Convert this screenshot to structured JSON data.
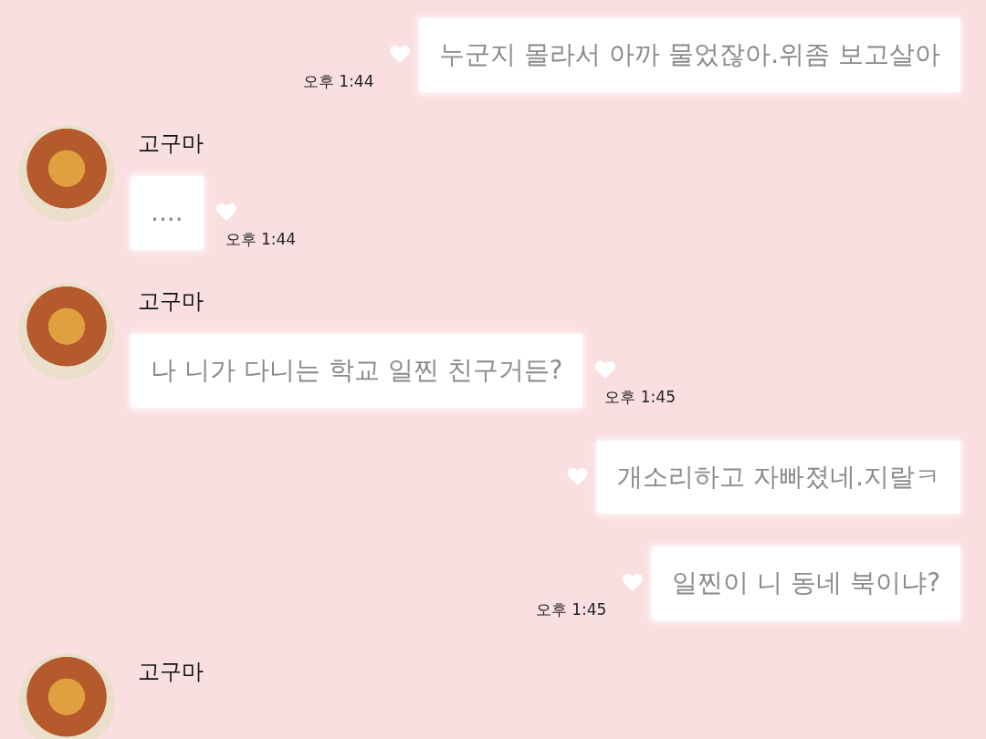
{
  "messages": [
    {
      "kind": "sent",
      "text": "누군지 몰라서 아까 물었잖아.위좀 보고살아",
      "time": "오후 1:44"
    },
    {
      "kind": "received",
      "sender": "고구마",
      "text": "....",
      "time": "오후 1:44"
    },
    {
      "kind": "received",
      "sender": "고구마",
      "text": "나 니가 다니는 학교 일찐 친구거든?",
      "time": "오후 1:45"
    },
    {
      "kind": "sent",
      "text": "개소리하고 자빠졌네.지랄ㅋ"
    },
    {
      "kind": "sent",
      "text": "일찐이 니 동네 북이냐?",
      "time": "오후 1:45"
    },
    {
      "kind": "received",
      "sender": "고구마"
    }
  ]
}
